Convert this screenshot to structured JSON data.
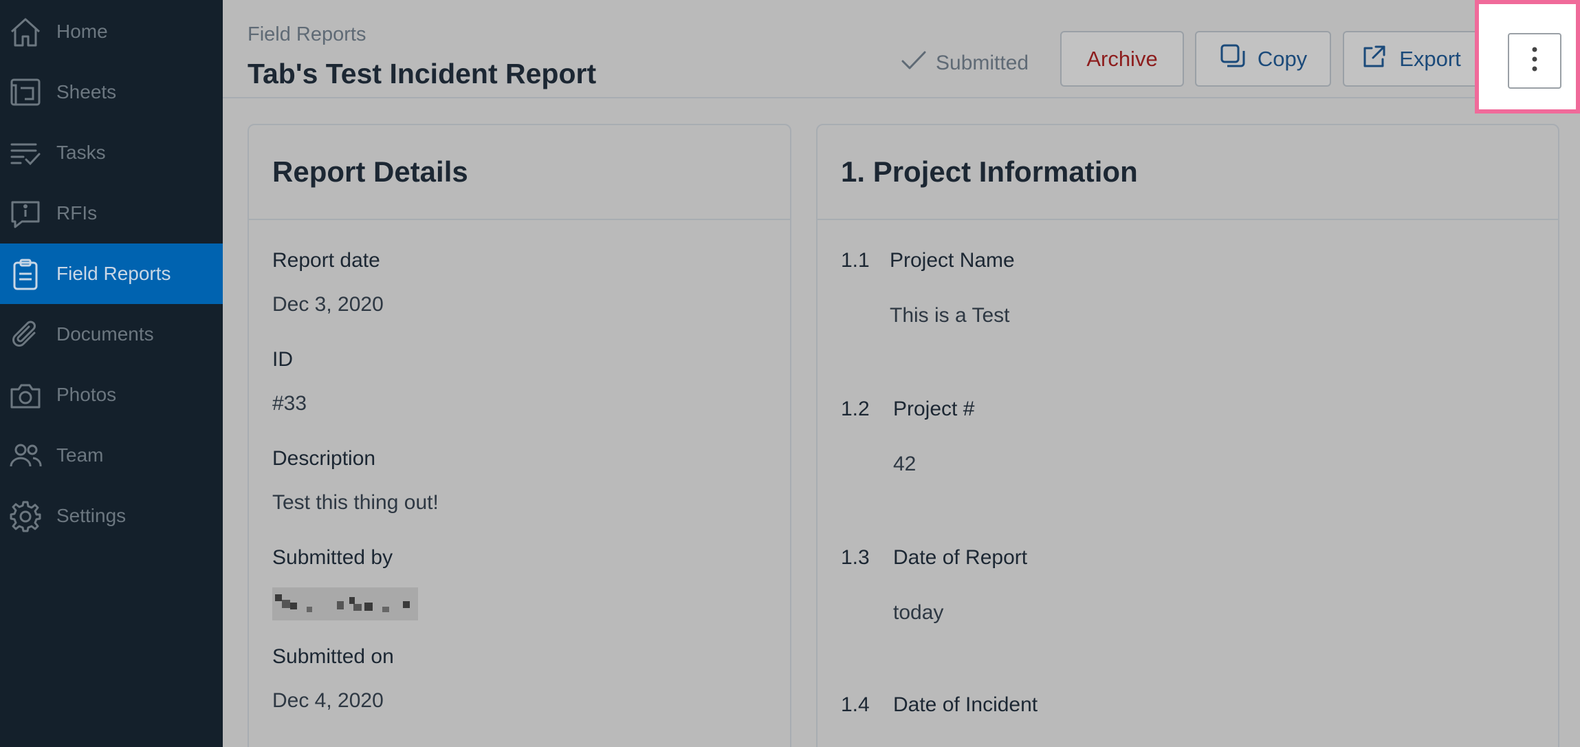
{
  "sidebar": {
    "items": [
      {
        "label": "Home",
        "icon": "home-icon"
      },
      {
        "label": "Sheets",
        "icon": "sheets-icon"
      },
      {
        "label": "Tasks",
        "icon": "tasks-icon"
      },
      {
        "label": "RFIs",
        "icon": "rfi-icon"
      },
      {
        "label": "Field Reports",
        "icon": "clipboard-icon",
        "active": true
      },
      {
        "label": "Documents",
        "icon": "paperclip-icon"
      },
      {
        "label": "Photos",
        "icon": "camera-icon"
      },
      {
        "label": "Team",
        "icon": "team-icon"
      },
      {
        "label": "Settings",
        "icon": "gear-icon"
      }
    ]
  },
  "header": {
    "breadcrumb": "Field Reports",
    "title": "Tab's Test Incident Report",
    "status": "Submitted",
    "archive_label": "Archive",
    "copy_label": "Copy",
    "export_label": "Export",
    "more_icon": "vertical-ellipsis-icon"
  },
  "report_details": {
    "title": "Report Details",
    "fields": [
      {
        "label": "Report date",
        "value": "Dec 3, 2020"
      },
      {
        "label": "ID",
        "value": "#33"
      },
      {
        "label": "Description",
        "value": "Test this thing out!"
      },
      {
        "label": "Submitted by",
        "value": ""
      },
      {
        "label": "Submitted on",
        "value": "Dec 4, 2020"
      }
    ]
  },
  "project_info": {
    "title": "1. Project Information",
    "questions": [
      {
        "num": "1.1",
        "label": "Project Name",
        "value": "This is a Test"
      },
      {
        "num": "1.2",
        "label": "Project #",
        "value": "42"
      },
      {
        "num": "1.3",
        "label": "Date of Report",
        "value": "today"
      },
      {
        "num": "1.4",
        "label": "Date of Incident",
        "value": ""
      }
    ]
  },
  "colors": {
    "sidebar_bg": "#14202b",
    "active_nav": "#0063b0",
    "archive_text": "#8d1d1d",
    "highlight": "#f06a9a"
  }
}
